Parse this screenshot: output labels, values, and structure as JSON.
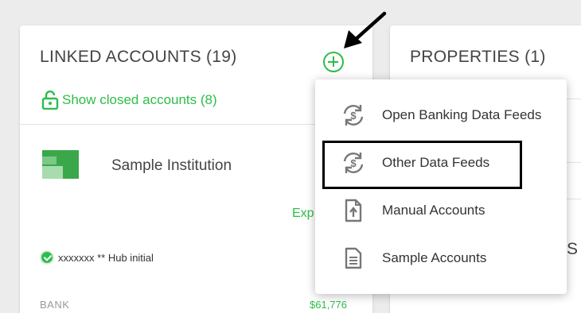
{
  "linked": {
    "title": "LINKED ACCOUNTS (19)",
    "show_closed": "Show closed accounts (8)",
    "institution": "Sample Institution",
    "exp_text": "Exp",
    "account_line": "xxxxxxx ** Hub initial",
    "bank_label": "BANK",
    "bank_amount": "$61,776"
  },
  "properties": {
    "title": "PROPERTIES (1)",
    "trailing_text": "S"
  },
  "menu": {
    "items": [
      {
        "label": "Open Banking Data Feeds",
        "icon": "sync-dollar-icon"
      },
      {
        "label": "Other Data Feeds",
        "icon": "sync-dollar-icon"
      },
      {
        "label": "Manual Accounts",
        "icon": "file-upload-icon"
      },
      {
        "label": "Sample Accounts",
        "icon": "document-icon"
      }
    ]
  },
  "colors": {
    "accent": "#2ebd4b",
    "icon_gray": "#777777"
  }
}
